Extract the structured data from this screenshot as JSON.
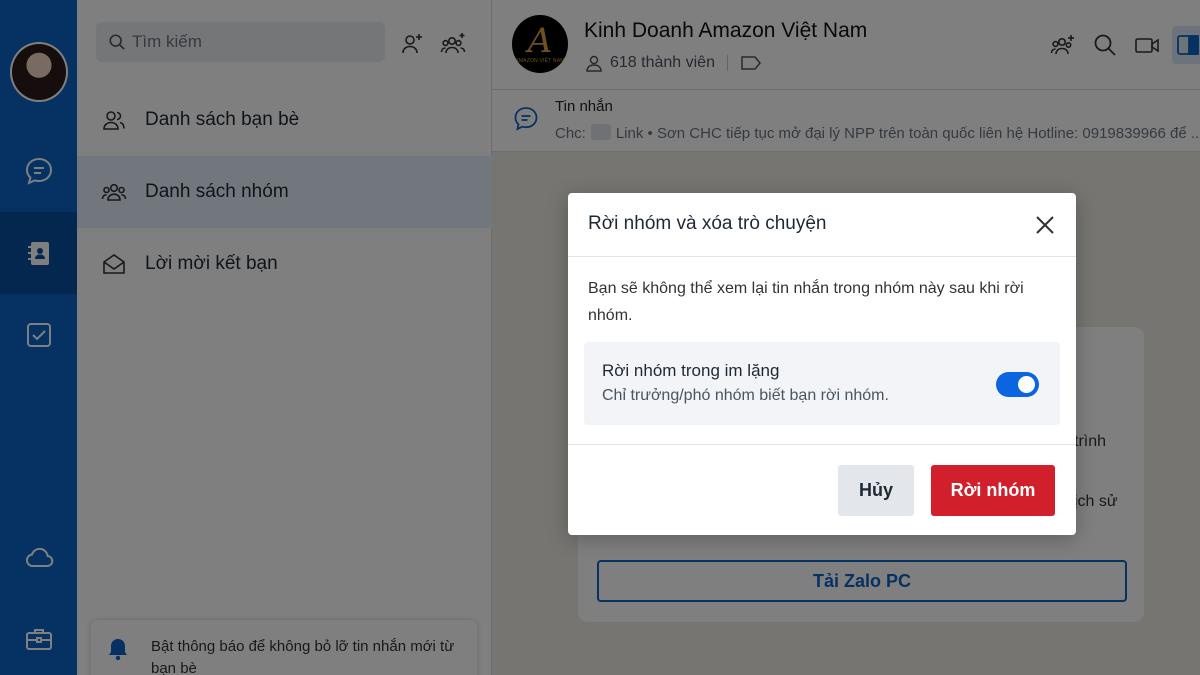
{
  "search": {
    "placeholder": "Tìm kiếm"
  },
  "sidebar": {
    "items": [
      {
        "label": "Danh sách bạn bè"
      },
      {
        "label": "Danh sách nhóm"
      },
      {
        "label": "Lời mời kết bạn"
      }
    ],
    "notification": "Bật thông báo để không bỏ lỡ tin nhắn mới từ bạn bè"
  },
  "chat": {
    "group_name": "Kinh Doanh Amazon Việt Nam",
    "members": "618 thành viên",
    "logo_text": "AMAZON VIỆT NAM",
    "pinned": {
      "title": "Tin nhắn",
      "sender": "Chc:",
      "text": "Link • Sơn CHC tiếp tục mở đại lý NPP trên toàn quốc liên hệ Hotline: 0919839966 để ..."
    },
    "card": {
      "fragment1": "trình",
      "fragment2": "ịch sử",
      "button": "Tải Zalo PC"
    }
  },
  "modal": {
    "title": "Rời nhóm và xóa trò chuyện",
    "description": "Bạn sẽ không thể xem lại tin nhắn trong nhóm này sau khi rời nhóm.",
    "option_title": "Rời nhóm trong im lặng",
    "option_subtitle": "Chỉ trưởng/phó nhóm biết bạn rời nhóm.",
    "silent_leave_enabled": true,
    "cancel_label": "Hủy",
    "confirm_label": "Rời nhóm"
  },
  "colors": {
    "rail": "#0b64c4",
    "accent": "#0b64e0",
    "danger": "#d11f2b"
  }
}
